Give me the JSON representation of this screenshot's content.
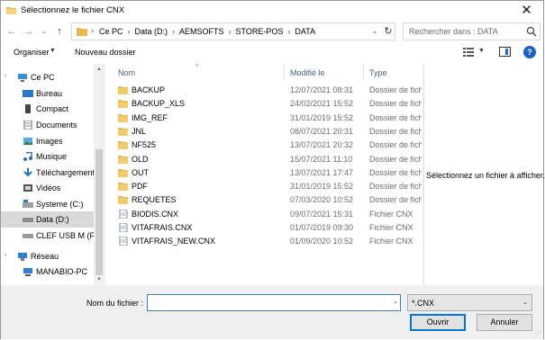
{
  "window": {
    "title": "Sélectionnez le fichier CNX",
    "close_glyph": "✕"
  },
  "address": {
    "crumbs": [
      "Ce PC",
      "Data (D:)",
      "AEMSOFTS",
      "STORE-POS",
      "DATA"
    ],
    "separator": "›"
  },
  "search": {
    "placeholder": "Rechercher dans : DATA"
  },
  "toolbar": {
    "organize": "Organiser",
    "new_folder": "Nouveau dossier",
    "help": "?"
  },
  "sidebar": {
    "items": [
      {
        "label": "Ce PC",
        "icon": "pc-icon",
        "indent": 0,
        "selected": false
      },
      {
        "label": "Bureau",
        "icon": "desktop-icon",
        "indent": 1,
        "selected": false
      },
      {
        "label": "Compact",
        "icon": "phone-icon",
        "indent": 1,
        "selected": false
      },
      {
        "label": "Documents",
        "icon": "documents-icon",
        "indent": 1,
        "selected": false
      },
      {
        "label": "Images",
        "icon": "images-icon",
        "indent": 1,
        "selected": false
      },
      {
        "label": "Musique",
        "icon": "music-icon",
        "indent": 1,
        "selected": false
      },
      {
        "label": "Téléchargement",
        "icon": "download-icon",
        "indent": 1,
        "selected": false
      },
      {
        "label": "Vidéos",
        "icon": "videos-icon",
        "indent": 1,
        "selected": false
      },
      {
        "label": "Systeme (C:)",
        "icon": "windows-drive-icon",
        "indent": 1,
        "selected": false
      },
      {
        "label": "Data (D:)",
        "icon": "drive-icon",
        "indent": 1,
        "selected": true
      },
      {
        "label": "CLEF USB M (F:)",
        "icon": "usb-drive-icon",
        "indent": 1,
        "selected": false
      },
      {
        "label": "Réseau",
        "icon": "network-icon",
        "indent": 0,
        "selected": false
      },
      {
        "label": "MANABIO-PC",
        "icon": "computer-icon",
        "indent": 1,
        "selected": false
      }
    ]
  },
  "columns": {
    "name": "Nom",
    "modified": "Modifié le",
    "type": "Type"
  },
  "files": [
    {
      "name": "BACKUP",
      "date": "12/07/2021 08:31",
      "type": "Dossier de fichiers",
      "kind": "folder"
    },
    {
      "name": "BACKUP_XLS",
      "date": "24/02/2021 15:52",
      "type": "Dossier de fichiers",
      "kind": "folder"
    },
    {
      "name": "IMG_REF",
      "date": "31/01/2019 15:52",
      "type": "Dossier de fichiers",
      "kind": "folder"
    },
    {
      "name": "JNL",
      "date": "08/07/2021 20:31",
      "type": "Dossier de fichiers",
      "kind": "folder"
    },
    {
      "name": "NF525",
      "date": "13/07/2021 20:32",
      "type": "Dossier de fichiers",
      "kind": "folder"
    },
    {
      "name": "OLD",
      "date": "15/07/2021 11:10",
      "type": "Dossier de fichiers",
      "kind": "folder"
    },
    {
      "name": "OUT",
      "date": "13/07/2021 17:47",
      "type": "Dossier de fichiers",
      "kind": "folder"
    },
    {
      "name": "PDF",
      "date": "31/01/2019 15:52",
      "type": "Dossier de fichiers",
      "kind": "folder"
    },
    {
      "name": "REQUETES",
      "date": "07/03/2020 10:52",
      "type": "Dossier de fichiers",
      "kind": "folder"
    },
    {
      "name": "BIODIS.CNX",
      "date": "09/07/2021 15:31",
      "type": "Fichier CNX",
      "kind": "file"
    },
    {
      "name": "VITAFRAIS.CNX",
      "date": "01/07/2019 09:30",
      "type": "Fichier CNX",
      "kind": "file"
    },
    {
      "name": "VITAFRAIS_NEW.CNX",
      "date": "01/09/2020 10:52",
      "type": "Fichier CNX",
      "kind": "file"
    }
  ],
  "preview": {
    "message": "Sélectionnez un fichier à afficher."
  },
  "bottom": {
    "filename_label": "Nom du fichier :",
    "filename_value": "",
    "filter": "*.CNX",
    "open": "Ouvrir",
    "cancel": "Annuler"
  },
  "colors": {
    "folder": "#e8b84a",
    "selection": "#d9d9d9",
    "accent": "#0078d7"
  }
}
